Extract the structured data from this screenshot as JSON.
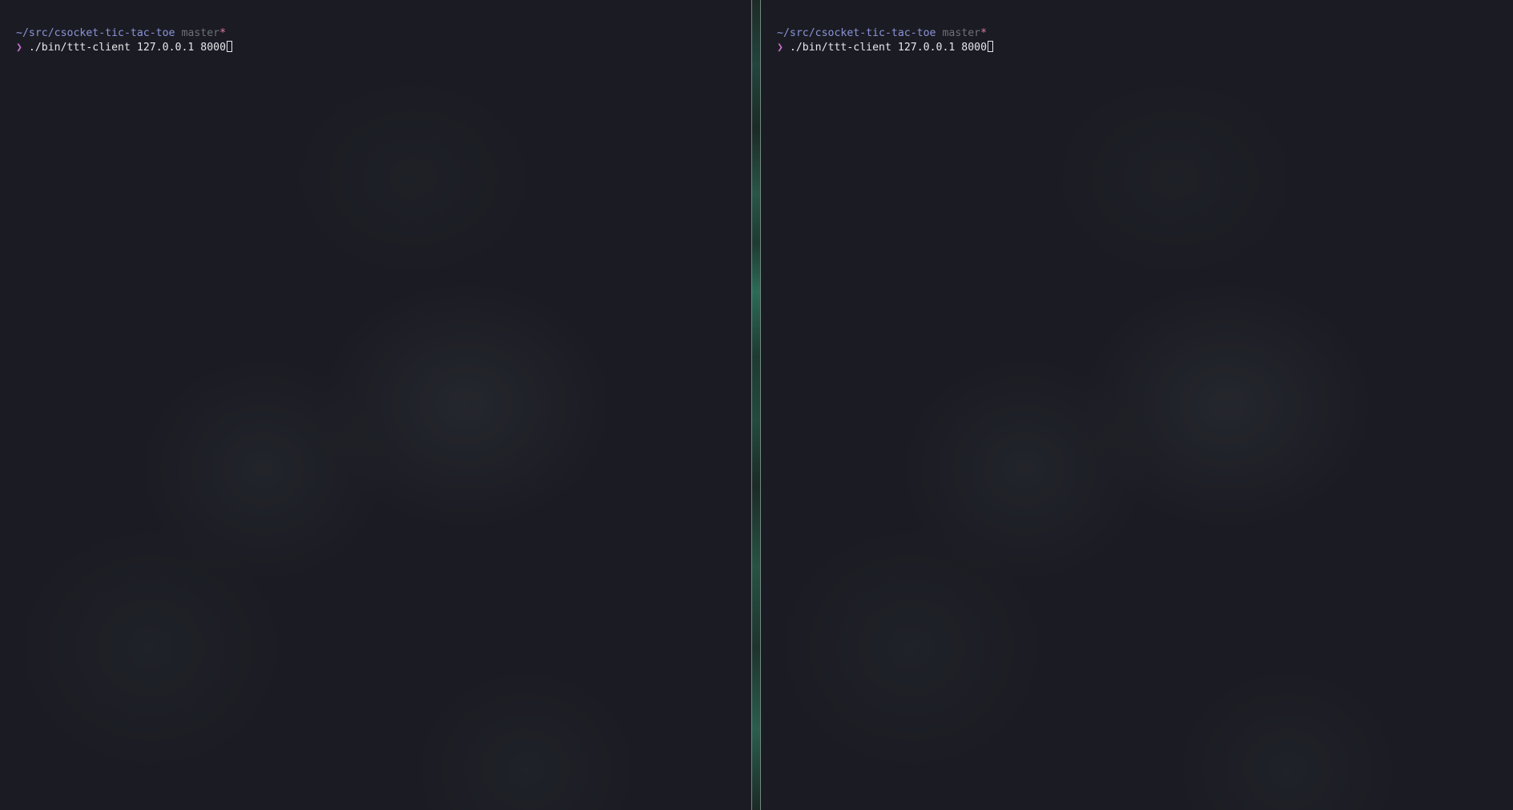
{
  "panes": {
    "left": {
      "prompt_path": "~/src/csocket-tic-tac-toe",
      "git_branch": "master",
      "git_dirty_marker": "*",
      "prompt_symbol": "❯",
      "command": "./bin/ttt-client 127.0.0.1 8000"
    },
    "right": {
      "prompt_path": "~/src/csocket-tic-tac-toe",
      "git_branch": "master",
      "git_dirty_marker": "*",
      "prompt_symbol": "❯",
      "command": "./bin/ttt-client 127.0.0.1 8000"
    }
  },
  "colors": {
    "background": "#1b1c23",
    "path": "#8c93d9",
    "branch": "#6d6f79",
    "dirty_marker": "#e27aa8",
    "prompt_symbol": "#c46fd4",
    "command_text": "#e6e7ec",
    "divider": "#2d6a58"
  }
}
